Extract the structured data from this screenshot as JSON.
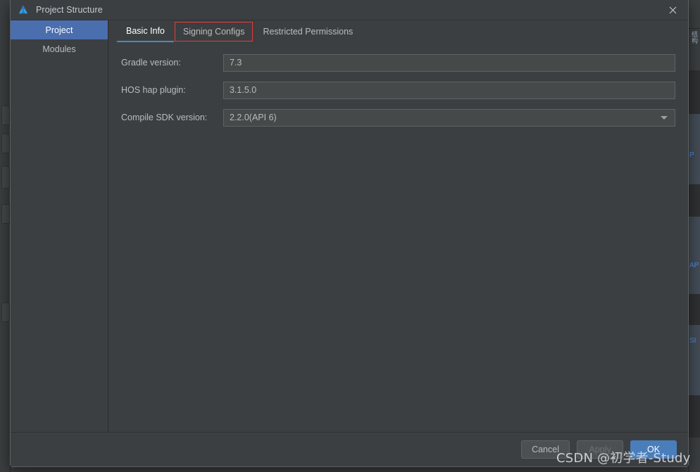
{
  "window": {
    "title": "Project Structure",
    "app_icon": "deveco-studio-icon",
    "close_label": "×"
  },
  "sidebar": {
    "items": [
      {
        "label": "Project",
        "selected": true
      },
      {
        "label": "Modules",
        "selected": false
      }
    ]
  },
  "tabs": [
    {
      "label": "Basic Info",
      "active": true,
      "annotated": false
    },
    {
      "label": "Signing Configs",
      "active": false,
      "annotated": true
    },
    {
      "label": "Restricted Permissions",
      "active": false,
      "annotated": false
    }
  ],
  "form": {
    "fields": [
      {
        "label": "Gradle version:",
        "value": "7.3",
        "type": "text"
      },
      {
        "label": "HOS hap plugin:",
        "value": "3.1.5.0",
        "type": "text"
      },
      {
        "label": "Compile SDK version:",
        "value": "2.2.0(API 6)",
        "type": "combo"
      }
    ]
  },
  "footer": {
    "cancel_label": "Cancel",
    "apply_label": "Apply",
    "ok_label": "OK"
  },
  "watermark": {
    "text": "CSDN @初学者-Study"
  },
  "background_ide": {
    "right_vertical_text": "结构",
    "right_items": [
      "P",
      "AP",
      "SI"
    ]
  },
  "colors": {
    "accent": "#4b6eaf",
    "tab_underline": "#4a88c7",
    "annotation": "#e03c3c",
    "primary_button": "#4a7ebb",
    "dialog_bg": "#3c3f41",
    "field_bg": "#45494a"
  }
}
